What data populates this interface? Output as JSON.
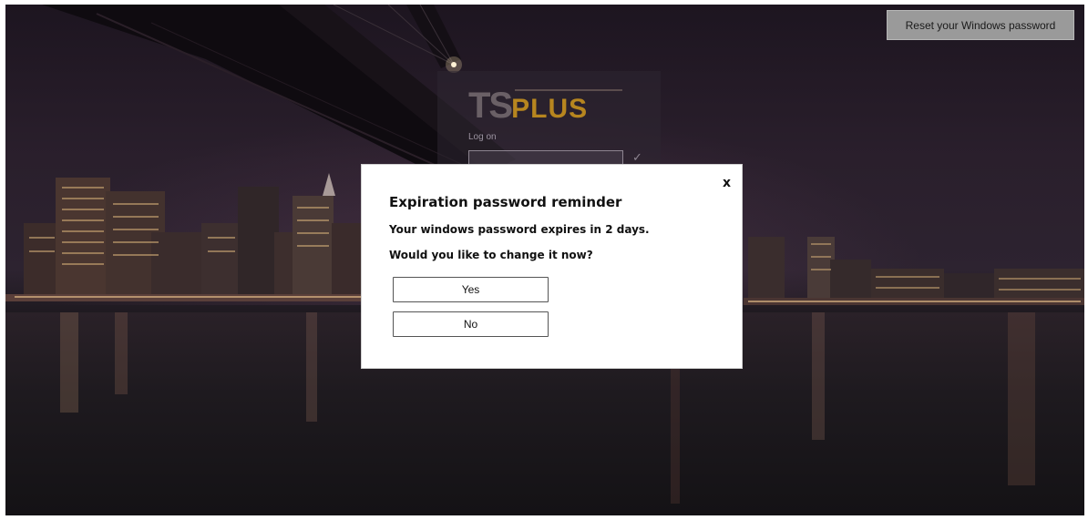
{
  "top_right": {
    "reset_label": "Reset your Windows password"
  },
  "login": {
    "logo_ts": "TS",
    "logo_plus": "PLUS",
    "logon_label": "Log on",
    "check_icon": "checkmark-icon"
  },
  "modal": {
    "close_label": "x",
    "title": "Expiration password reminder",
    "message_expires": "Your windows password expires in 2 days.",
    "message_question": "Would you like to change it now?",
    "yes_label": "Yes",
    "no_label": "No"
  },
  "colors": {
    "logo_plus": "#b7861f",
    "reset_button_bg": "#9a9a9a"
  }
}
